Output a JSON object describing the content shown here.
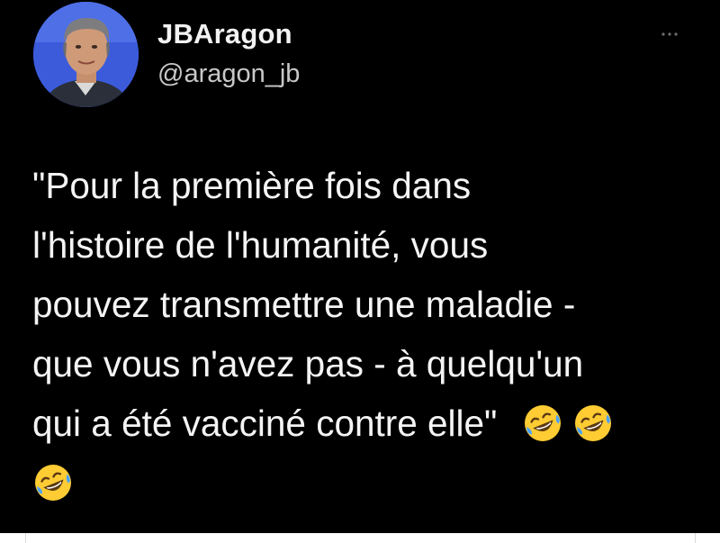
{
  "tweet": {
    "author": {
      "display_name": "JBAragon",
      "handle": "@aragon_jb"
    },
    "more_icon": "ellipsis-icon",
    "text_lines": [
      "\"Pour la première fois dans",
      "l'histoire de l'humanité, vous",
      "pouvez transmettre une maladie -",
      "que vous n'avez pas - à quelqu'un",
      "qui a été vacciné contre elle\""
    ],
    "emoji": "rolling-on-the-floor-laughing-emoji",
    "emoji_count": 3,
    "colors": {
      "background": "#000000",
      "text": "#f4f4f4",
      "handle": "#c8c8c8",
      "emoji_face": "#ffcc33",
      "avatar_bg": "#3b5bdb"
    }
  }
}
